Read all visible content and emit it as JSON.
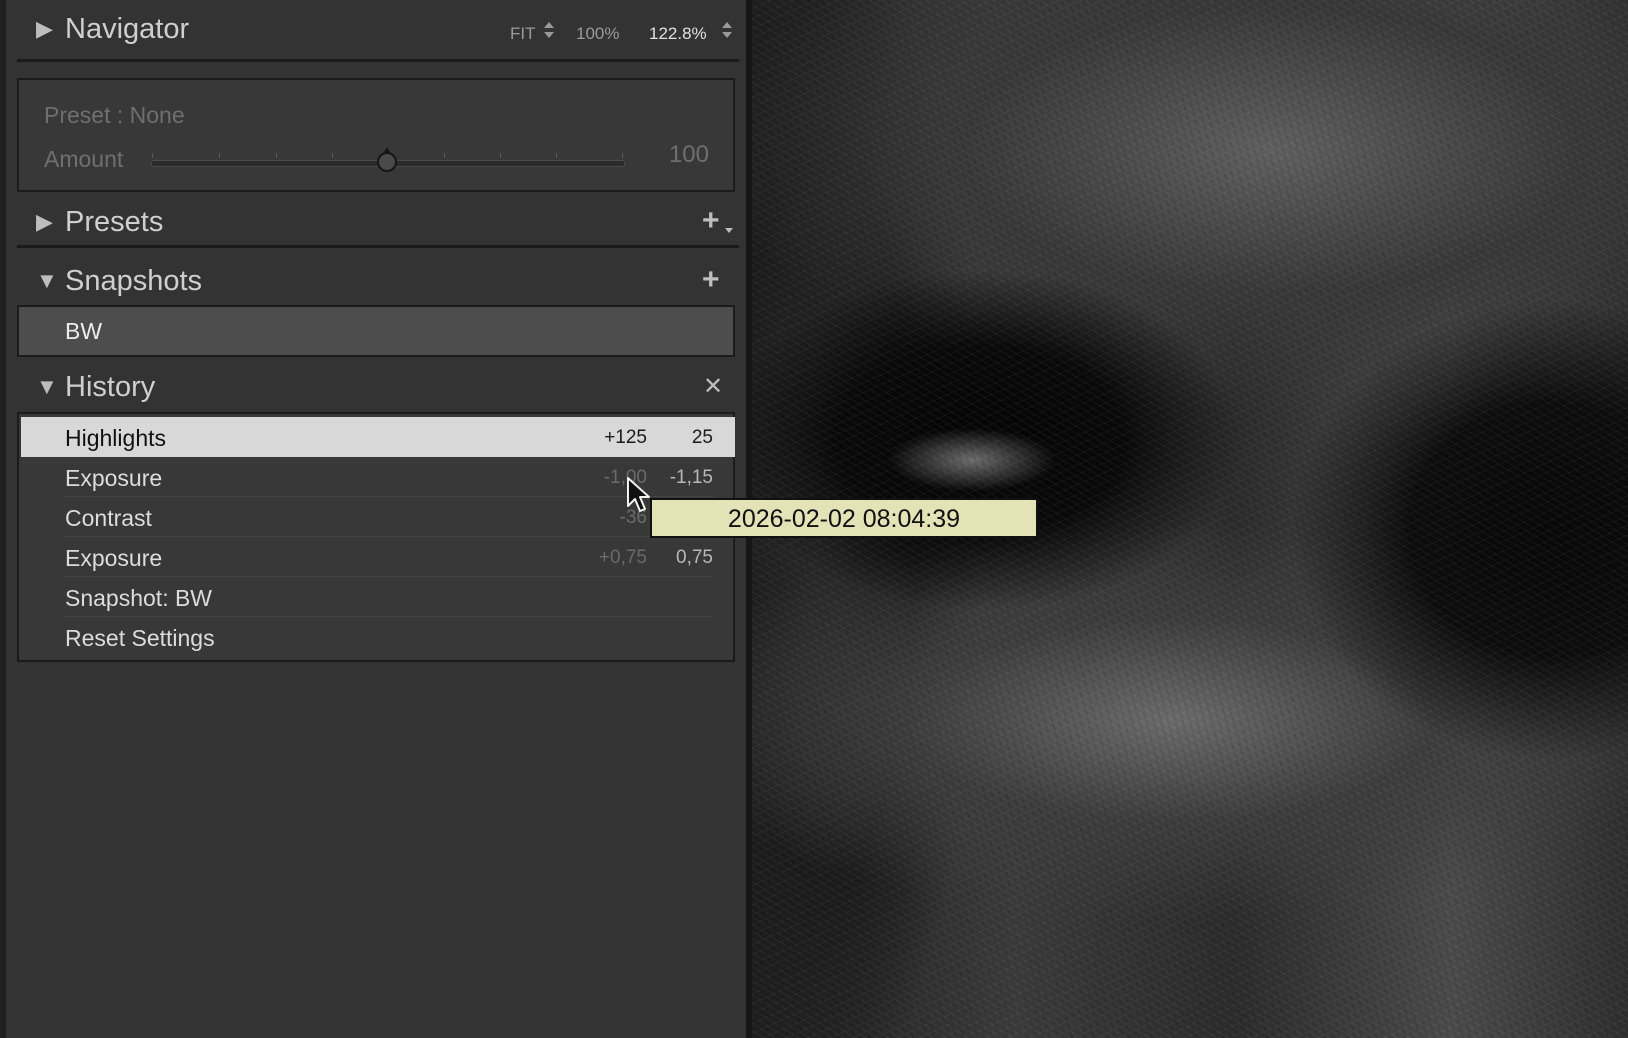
{
  "navigator": {
    "title": "Navigator",
    "zoom_fit": "FIT",
    "zoom_100": "100%",
    "zoom_current": "122.8%"
  },
  "preset_amount": {
    "preset_label": "Preset : None",
    "amount_label": "Amount",
    "amount_value": "100",
    "amount_level_fraction": 0.5
  },
  "presets": {
    "title": "Presets"
  },
  "snapshots": {
    "title": "Snapshots",
    "items": [
      {
        "label": "BW"
      }
    ]
  },
  "history": {
    "title": "History",
    "items": [
      {
        "name": "Highlights",
        "delta": "+125",
        "value": "25",
        "selected": true
      },
      {
        "name": "Exposure",
        "delta": "-1,00",
        "value": "-1,15"
      },
      {
        "name": "Contrast",
        "delta": "-36",
        "value": ""
      },
      {
        "name": "Exposure",
        "delta": "+0,75",
        "value": "0,75"
      },
      {
        "name": "Snapshot: BW",
        "delta": "",
        "value": ""
      },
      {
        "name": "Reset Settings",
        "delta": "",
        "value": ""
      }
    ]
  },
  "tooltip": {
    "text": "2026-02-02 08:04:39"
  },
  "colors": {
    "panel_bg": "#333333",
    "selected_row": "#d8d8d8",
    "tooltip_bg": "#e4e2b7"
  }
}
